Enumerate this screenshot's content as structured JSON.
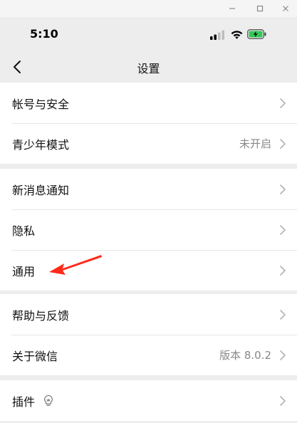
{
  "status": {
    "time": "5:10"
  },
  "nav": {
    "title": "设置"
  },
  "groups": [
    {
      "items": [
        {
          "label": "帐号与安全",
          "value": ""
        },
        {
          "label": "青少年模式",
          "value": "未开启"
        }
      ]
    },
    {
      "items": [
        {
          "label": "新消息通知",
          "value": ""
        },
        {
          "label": "隐私",
          "value": ""
        },
        {
          "label": "通用",
          "value": ""
        }
      ]
    },
    {
      "items": [
        {
          "label": "帮助与反馈",
          "value": ""
        },
        {
          "label": "关于微信",
          "value": "版本 8.0.2"
        }
      ]
    },
    {
      "items": [
        {
          "label": "插件",
          "value": ""
        }
      ]
    }
  ],
  "icons": {
    "back": "chevron-left-icon",
    "row_arrow": "chevron-right-icon",
    "plugin_badge": "lightbulb-icon",
    "annotation": "red-arrow-icon"
  },
  "colors": {
    "background": "#ededed",
    "row_background": "#ffffff",
    "value_text": "#888888",
    "battery_charging": "#34c759",
    "annotation_arrow": "#ff2a1a"
  }
}
